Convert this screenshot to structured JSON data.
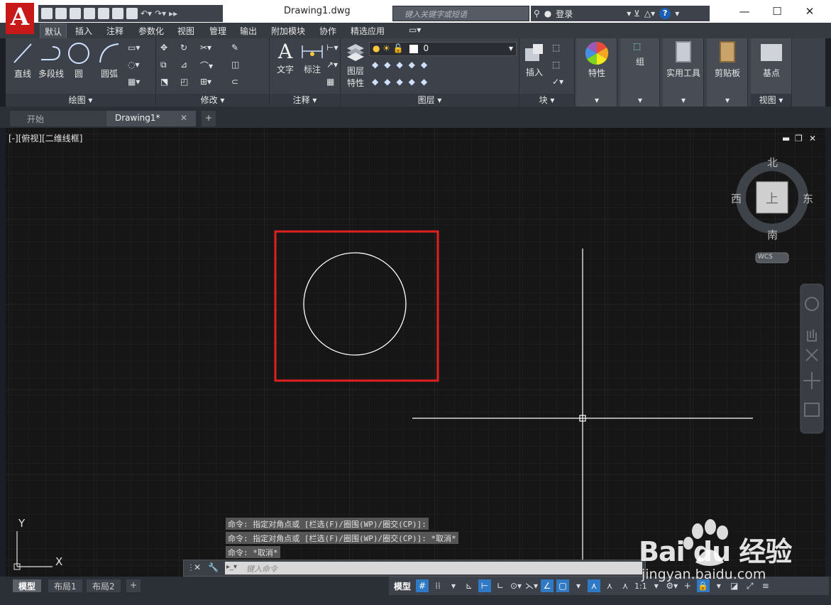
{
  "app": {
    "logo_letter": "A",
    "document_name": "Drawing1.dwg"
  },
  "search": {
    "placeholder": "键入关键字或短语"
  },
  "account": {
    "login_label": "登录"
  },
  "ribbon_tabs": [
    "默认",
    "插入",
    "注释",
    "参数化",
    "视图",
    "管理",
    "输出",
    "附加模块",
    "协作",
    "精选应用"
  ],
  "panels": {
    "draw": {
      "title": "绘图",
      "tools": [
        "直线",
        "多段线",
        "圆",
        "圆弧"
      ]
    },
    "modify": {
      "title": "修改"
    },
    "annotation": {
      "title": "注释",
      "tools": [
        "文字",
        "标注"
      ]
    },
    "layers": {
      "title": "图层",
      "properties_label": "图层",
      "properties_label2": "特性",
      "current_layer": "0"
    },
    "block": {
      "title": "块",
      "insert_label": "插入"
    },
    "properties": {
      "label": "特性"
    },
    "groups": {
      "label": "组"
    },
    "utilities": {
      "label": "实用工具"
    },
    "clipboard": {
      "label": "剪贴板"
    },
    "view": {
      "title": "视图",
      "label": "基点"
    }
  },
  "doc_tabs": [
    {
      "label": "开始"
    },
    {
      "label": "Drawing1*"
    }
  ],
  "viewport": {
    "label": "[-][俯视][二维线框]"
  },
  "viewcube": {
    "north": "北",
    "south": "南",
    "east": "东",
    "west": "西",
    "top": "上",
    "wcs": "WCS"
  },
  "ucs": {
    "x": "X",
    "y": "Y"
  },
  "command_history": [
    "命令: 指定对角点或 [栏选(F)/圈围(WP)/圈交(CP)]:",
    "命令: 指定对角点或 [栏选(F)/圈围(WP)/圈交(CP)]: *取消*",
    "命令: *取消*"
  ],
  "command_input": {
    "placeholder": "键入命令"
  },
  "layout_tabs": [
    "模型",
    "布局1",
    "布局2"
  ],
  "status": {
    "model_label": "模型",
    "scale": "1:1"
  },
  "watermark": {
    "brand": "Bai du 经验",
    "url": "jingyan.baidu.com"
  },
  "colors": {
    "accent_red": "#c81919",
    "selection_red": "#e02020",
    "drawing_bg": "#161616",
    "ribbon_bg": "#3d4149",
    "active_blue": "#2f79c5"
  }
}
